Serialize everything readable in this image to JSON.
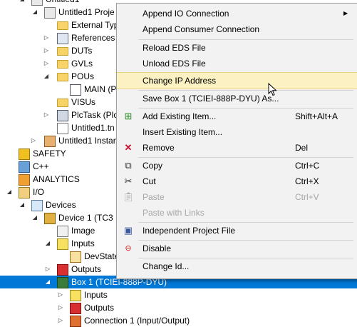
{
  "tree": {
    "top_cut_label": "Untitled1",
    "project_label": "Untitled1 Proje",
    "external_types": "External Typ",
    "references": "References",
    "duts": "DUTs",
    "gvls": "GVLs",
    "pous": "POUs",
    "main": "MAIN (P",
    "visus": "VISUs",
    "plctask": "PlcTask (Plc",
    "untitled1_tmc": "Untitled1.tn",
    "untitled1_instance": "Untitled1 Instan",
    "safety": "SAFETY",
    "cpp": "C++",
    "analytics": "ANALYTICS",
    "io": "I/O",
    "devices": "Devices",
    "device1": "Device 1 (TC3 E",
    "image": "Image",
    "inputs": "Inputs",
    "devstate": "DevState",
    "outputs": "Outputs",
    "box1": "Box 1 (TCIEI-888P-DYU)",
    "box_inputs": "Inputs",
    "box_outputs": "Outputs",
    "connection1": "Connection 1 (Input/Output)"
  },
  "menu": {
    "items": [
      {
        "label": "Append IO Connection",
        "shortcut": "",
        "submenu": true
      },
      {
        "label": "Append Consumer Connection",
        "shortcut": ""
      },
      {
        "label": "Reload EDS File",
        "shortcut": ""
      },
      {
        "label": "Unload EDS File",
        "shortcut": ""
      },
      {
        "label": "Change IP Address",
        "shortcut": ""
      },
      {
        "label": "Save Box 1 (TCIEI-888P-DYU) As...",
        "shortcut": ""
      },
      {
        "label": "Add Existing Item...",
        "shortcut": "Shift+Alt+A"
      },
      {
        "label": "Insert Existing Item...",
        "shortcut": ""
      },
      {
        "label": "Remove",
        "shortcut": "Del"
      },
      {
        "label": "Copy",
        "shortcut": "Ctrl+C"
      },
      {
        "label": "Cut",
        "shortcut": "Ctrl+X"
      },
      {
        "label": "Paste",
        "shortcut": "Ctrl+V"
      },
      {
        "label": "Paste with Links",
        "shortcut": ""
      },
      {
        "label": "Independent Project File",
        "shortcut": ""
      },
      {
        "label": "Disable",
        "shortcut": ""
      },
      {
        "label": "Change Id...",
        "shortcut": ""
      }
    ]
  },
  "colors": {
    "selection": "#0078d7",
    "menu_background": "#f2f2f2",
    "menu_highlight": "#fcf1c2",
    "disabled_text": "#a6a6a6"
  }
}
